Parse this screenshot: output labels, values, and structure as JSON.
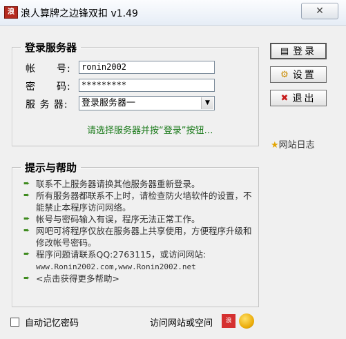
{
  "window": {
    "title": "浪人算牌之边锋双扣 v1.49",
    "app_icon_glyph": "浪",
    "close_glyph": "✕"
  },
  "login": {
    "legend": "登录服务器",
    "account_label": "帐　　号:",
    "account_value": "ronin2002",
    "password_label": "密　　码:",
    "password_value": "*********",
    "server_label": "服 务 器:",
    "server_selected": "登录服务器一",
    "hint": "请选择服务器并按“登录”按钮…"
  },
  "actions": {
    "login_label": "登录",
    "settings_label": "设置",
    "exit_label": "退出",
    "news_label": "网站日志"
  },
  "help": {
    "legend": "提示与帮助",
    "items": [
      "联系不上服务器请换其他服务器重新登录。",
      "所有服务器都联系不上时，请检查防火墙软件的设置，不能禁止本程序访问网络。",
      "帐号与密码输入有误，程序无法正常工作。",
      "网吧可将程序仅放在服务器上共享使用，方便程序升级和修改帐号密码。",
      "程序问题请联系QQ:2763115，或访问网站:",
      "<点击获得更多帮助>"
    ],
    "websites": "www.Ronin2002.com,www.Ronin2002.net"
  },
  "footer": {
    "remember_label": "自动记忆密码",
    "remember_checked": false,
    "visit_label": "访问网站或空间"
  },
  "colors": {
    "hint_green": "#1a7a1a",
    "bullet_green": "#3d8a1d"
  },
  "icons": [
    "app-icon",
    "close-icon",
    "login-icon",
    "settings-icon",
    "exit-icon",
    "star-icon",
    "bullet-arrow-icon",
    "site-icon",
    "space-icon"
  ]
}
